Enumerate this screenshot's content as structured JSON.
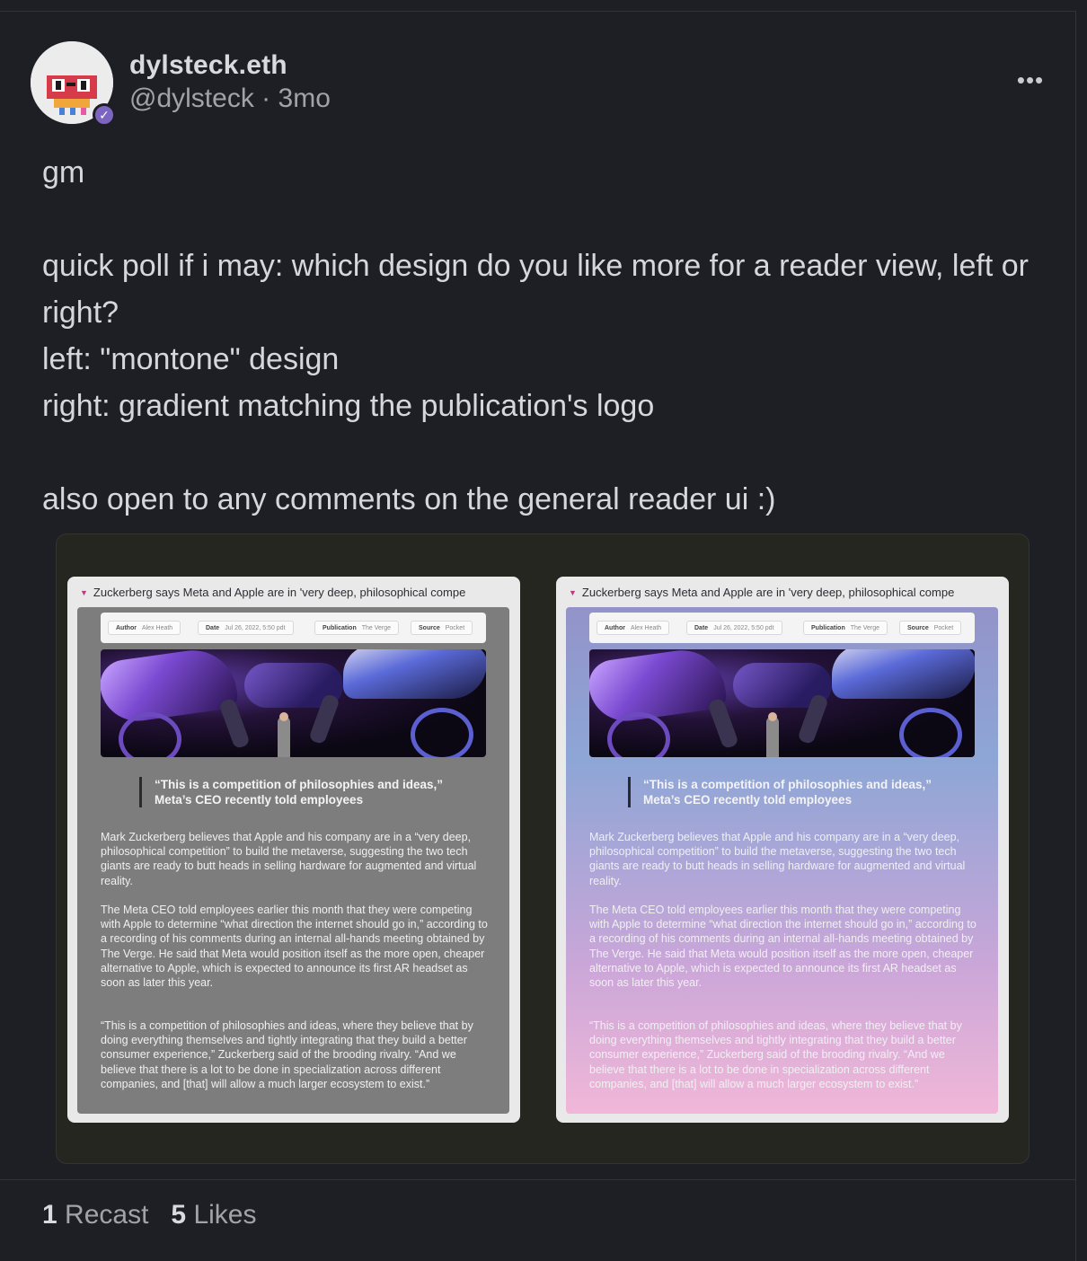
{
  "post": {
    "display_name": "dylsteck.eth",
    "handle": "@dylsteck",
    "separator": "·",
    "age": "3mo",
    "text": "gm\n\nquick poll if i may: which design do you like more for a reader view, left or right?\nleft: \"montone\" design\nright: gradient matching the publication's logo\n\nalso open to any comments on the general reader ui :)",
    "more_icon": "ellipsis-icon",
    "verified_icon": "check-icon"
  },
  "image": {
    "cards": [
      {
        "title": "Zuckerberg says Meta and Apple are in 'very deep, philosophical compe",
        "meta": [
          {
            "key": "Author",
            "value": "Alex Heath"
          },
          {
            "key": "Date",
            "value": "Jul 26, 2022, 5:50 pdt"
          },
          {
            "key": "Publication",
            "value": "The Verge"
          },
          {
            "key": "Source",
            "value": "Pocket"
          }
        ],
        "pull_quote": "“This is a competition of philosophies and ideas,” Meta’s CEO recently told employees",
        "paragraphs": [
          "Mark Zuckerberg believes that Apple and his company are in a “very deep, philosophical competition” to build the metaverse, suggesting the two tech giants are ready to butt heads in selling hardware for augmented and virtual reality.",
          "The Meta CEO told employees earlier this month that they were competing with Apple to determine “what direction the internet should go in,” according to a recording of his comments during an internal all-hands meeting obtained by The Verge. He said that Meta would position itself as the more open, cheaper alternative to Apple, which is expected to announce its first AR headset as soon as later this year.",
          "“This is a competition of philosophies and ideas, where they believe that by doing everything themselves and tightly integrating that they build a better consumer experience,” Zuckerberg said of the brooding rivalry. “And we believe that there is a lot to be done in specialization across different companies, and [that] will allow a much larger ecosystem to exist.”"
        ]
      },
      {
        "title": "Zuckerberg says Meta and Apple are in 'very deep, philosophical compe",
        "meta": [
          {
            "key": "Author",
            "value": "Alex Heath"
          },
          {
            "key": "Date",
            "value": "Jul 26, 2022, 5:50 pdt"
          },
          {
            "key": "Publication",
            "value": "The Verge"
          },
          {
            "key": "Source",
            "value": "Pocket"
          }
        ],
        "pull_quote": "“This is a competition of philosophies and ideas,” Meta’s CEO recently told employees",
        "paragraphs": [
          "Mark Zuckerberg believes that Apple and his company are in a “very deep, philosophical competition” to build the metaverse, suggesting the two tech giants are ready to butt heads in selling hardware for augmented and virtual reality.",
          "The Meta CEO told employees earlier this month that they were competing with Apple to determine “what direction the internet should go in,” according to a recording of his comments during an internal all-hands meeting obtained by The Verge. He said that Meta would position itself as the more open, cheaper alternative to Apple, which is expected to announce its first AR headset as soon as later this year.",
          "“This is a competition of philosophies and ideas, where they believe that by doing everything themselves and tightly integrating that they build a better consumer experience,” Zuckerberg said of the brooding rivalry. “And we believe that there is a lot to be done in specialization across different companies, and [that] will allow a much larger ecosystem to exist.”"
        ]
      }
    ]
  },
  "engagement": {
    "recast_count": "1",
    "recast_label": "Recast",
    "likes_count": "5",
    "likes_label": "Likes"
  },
  "colors": {
    "background": "#1d1f24",
    "accent": "#7c65c1"
  }
}
